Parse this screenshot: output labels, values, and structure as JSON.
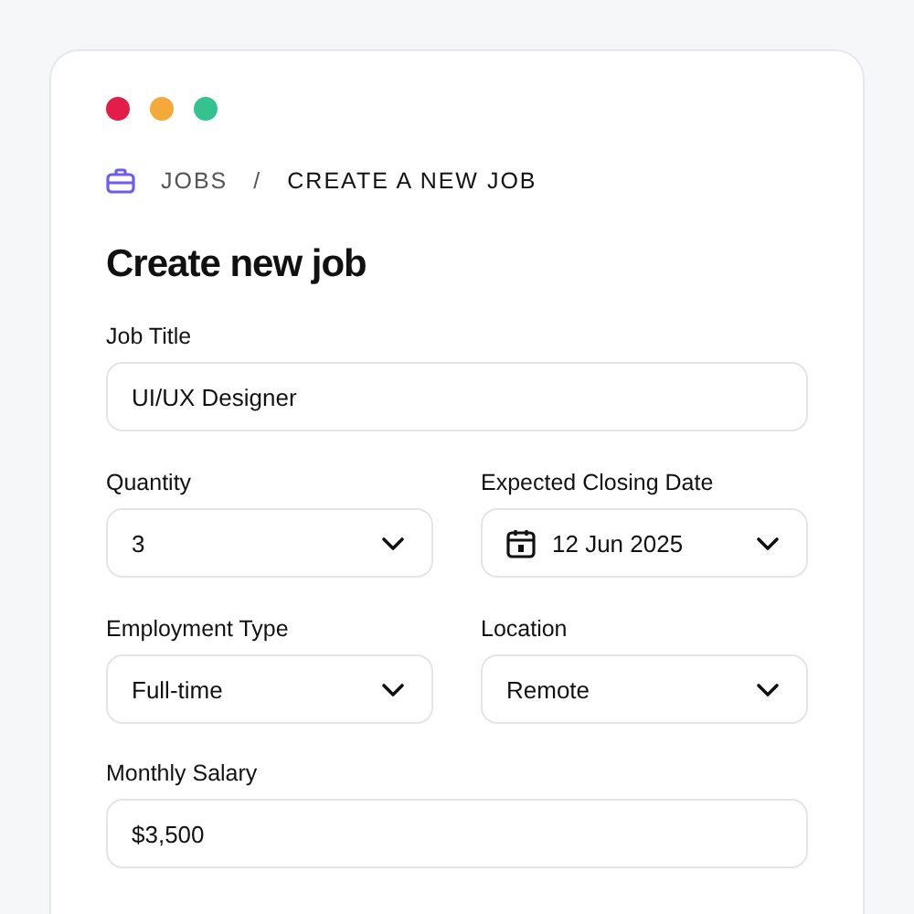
{
  "window_controls": [
    {
      "color": "#e11d48"
    },
    {
      "color": "#f4a93b"
    },
    {
      "color": "#34c38f"
    }
  ],
  "breadcrumb": [
    "JOBS",
    "CREATE A NEW JOB"
  ],
  "breadcrumb_separator": "/",
  "title": "Create new job",
  "form_rows": [
    [
      {
        "label": "Job Title",
        "kind": "text",
        "value": "UI/UX Designer"
      }
    ],
    [
      {
        "label": "Quantity",
        "kind": "select",
        "value": "3"
      },
      {
        "label": "Expected Closing Date",
        "kind": "date",
        "value": "12 Jun 2025"
      }
    ],
    [
      {
        "label": "Employment Type",
        "kind": "select",
        "value": "Full-time"
      },
      {
        "label": "Location",
        "kind": "select",
        "value": "Remote"
      }
    ],
    [
      {
        "label": "Monthly Salary",
        "kind": "text",
        "value": "$3,500"
      }
    ]
  ]
}
